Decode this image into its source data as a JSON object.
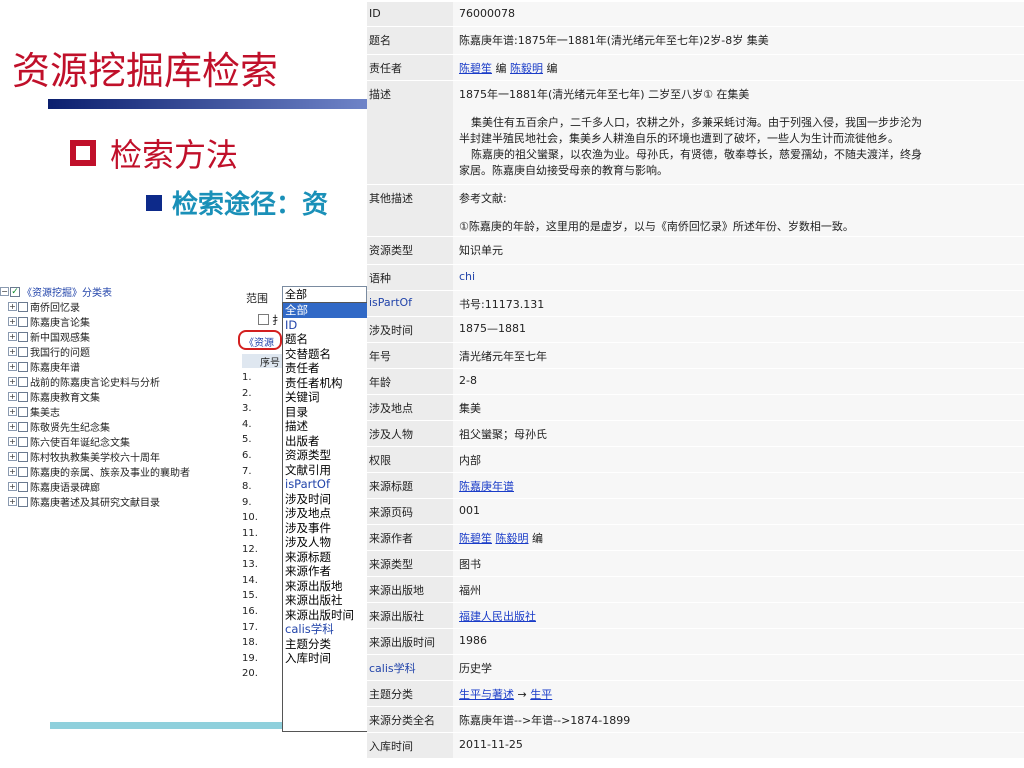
{
  "slide": {
    "title": "资源挖掘库检索",
    "bullet1": "检索方法",
    "bullet2": "检索途径：资"
  },
  "tree": {
    "root": "《资源挖掘》分类表",
    "items": [
      "南侨回忆录",
      "陈嘉庚言论集",
      "新中国观感集",
      "我国行的问题",
      "陈嘉庚年谱",
      "战前的陈嘉庚言论史料与分析",
      "陈嘉庚教育文集",
      "集美志",
      "陈敬贤先生纪念集",
      "陈六使百年诞纪念文集",
      "陈村牧执教集美学校六十周年",
      "陈嘉庚的亲属、族亲及事业的襄助者",
      "陈嘉庚语录碑廊",
      "陈嘉庚著述及其研究文献目录"
    ]
  },
  "search_panel": {
    "range_label": "范围",
    "range_value": "全部",
    "checkbox_label": "扌",
    "tab_label": "《资源",
    "list_header": "序号",
    "row_numbers": [
      "1.",
      "2.",
      "3.",
      "4.",
      "5.",
      "6.",
      "7.",
      "8.",
      "9.",
      "10.",
      "11.",
      "12.",
      "13.",
      "14.",
      "15.",
      "16.",
      "17.",
      "18.",
      "19.",
      "20."
    ],
    "dropdown_options": [
      "全部",
      "ID",
      "题名",
      "交替题名",
      "责任者",
      "责任者机构",
      "关键词",
      "目录",
      "描述",
      "出版者",
      "资源类型",
      "文献引用",
      "isPartOf",
      "涉及时间",
      "涉及地点",
      "涉及事件",
      "涉及人物",
      "来源标题",
      "来源作者",
      "来源出版地",
      "来源出版社",
      "来源出版时间",
      "calis学科",
      "主题分类",
      "入库时间"
    ],
    "selected_option": "全部"
  },
  "record": {
    "id_label": "ID",
    "id_value": "76000078",
    "title_label": "题名",
    "title_value": "陈嘉庚年谱:1875年一1881年(清光绪元年至七年)2岁-8岁 集美",
    "author_label": "责任者",
    "author_1": "陈碧笙",
    "author_edit_1": "编",
    "author_2": "陈毅明",
    "author_edit_2": "编",
    "desc_label": "描述",
    "desc_line1": "1875年一1881年(清光绪元年至七年) 二岁至八岁① 在集美",
    "desc_p1_a": "集美住有五百余户，二千多人口，农耕之外，多兼采蚝讨海。由于列强入侵，我国一步步沦为",
    "desc_p1_b": "半封建半殖民地社会，集美乡人耕渔自乐的环境也遭到了破坏，一些人为生计而流徙他乡。",
    "desc_p2_a": "陈嘉庚的祖父蠻聚，以农渔为业。母孙氏，有贤德，敬奉尊长，慈爱孺幼，不随夫渡洋，终身",
    "desc_p2_b": "家居。陈嘉庚自幼接受母亲的教育与影响。",
    "other_label": "其他描述",
    "other_line1": "参考文献:",
    "other_line2": "①陈嘉庚的年龄，这里用的是虚岁，以与《南侨回忆录》所述年份、岁数相一致。",
    "restype_label": "资源类型",
    "restype_value": "知识单元",
    "lang_label": "语种",
    "lang_value": "chi",
    "ispartof_label": "isPartOf",
    "ispartof_value": "书号:11173.131",
    "time_label": "涉及时间",
    "time_value": "1875—1881",
    "era_label": "年号",
    "era_value": "清光绪元年至七年",
    "age_label": "年龄",
    "age_value": "2-8",
    "place_label": "涉及地点",
    "place_value": "集美",
    "person_label": "涉及人物",
    "person_value": "祖父蠻聚；母孙氏",
    "rights_label": "权限",
    "rights_value": "内部",
    "src_title_label": "来源标题",
    "src_title_value": "陈嘉庚年谱",
    "src_page_label": "来源页码",
    "src_page_value": "001",
    "src_author_label": "来源作者",
    "src_author_1": "陈碧笙",
    "src_author_2": "陈毅明",
    "src_author_edit": "编",
    "src_type_label": "来源类型",
    "src_type_value": "图书",
    "src_place_label": "来源出版地",
    "src_place_value": "福州",
    "src_pub_label": "来源出版社",
    "src_pub_value": "福建人民出版社",
    "src_time_label": "来源出版时间",
    "src_time_value": "1986",
    "calis_label": "calis学科",
    "calis_value": "历史学",
    "subject_label": "主题分类",
    "subject_1": "生平与著述",
    "subject_arrow": "→",
    "subject_2": "生平",
    "fullcat_label": "来源分类全名",
    "fullcat_value": "陈嘉庚年谱-->年谱-->1874-1899",
    "intime_label": "入库时间",
    "intime_value": "2011-11-25"
  }
}
